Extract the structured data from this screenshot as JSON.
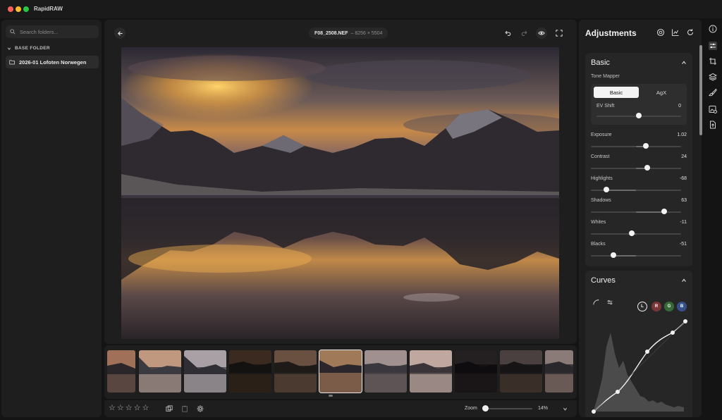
{
  "app": {
    "title": "RapidRAW"
  },
  "sidebar": {
    "search_placeholder": "Search folders...",
    "base_folder_label": "BASE FOLDER",
    "folders": [
      "2026-01 Lofoten Norwegen"
    ]
  },
  "viewer": {
    "filename": "F08_2508.NEF",
    "dimensions": "– 8256 × 5504"
  },
  "bottombar": {
    "rating_stars": 5,
    "zoom_label": "Zoom",
    "zoom_value": "14%",
    "zoom_level": 0.02
  },
  "adjustments": {
    "title": "Adjustments",
    "basic": {
      "title": "Basic",
      "tone_mapper_label": "Tone Mapper",
      "tone_options": [
        "Basic",
        "AgX"
      ],
      "selected_tone": "Basic",
      "ev_shift_label": "EV Shift",
      "ev_shift_value": "0",
      "sliders": [
        {
          "label": "Exposure",
          "value": "1.02"
        },
        {
          "label": "Contrast",
          "value": "24"
        },
        {
          "label": "Highlights",
          "value": "-68"
        },
        {
          "label": "Shadows",
          "value": "63"
        },
        {
          "label": "Whites",
          "value": "-11"
        },
        {
          "label": "Blacks",
          "value": "-51"
        }
      ]
    },
    "curves": {
      "title": "Curves",
      "channels": [
        "L",
        "R",
        "G",
        "B"
      ],
      "active_channel": "L"
    }
  },
  "colors": {
    "background": "#141414",
    "panel": "#1e1e1e",
    "accent": "#f2f2f2",
    "channel_r": "#b84a4a",
    "channel_g": "#4a8a4a",
    "channel_b": "#4a6ab8"
  }
}
